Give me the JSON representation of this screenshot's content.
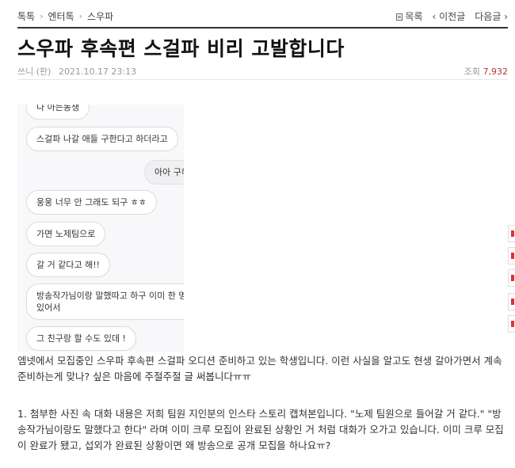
{
  "breadcrumb": {
    "item1": "톡톡",
    "item2": "엔터톡",
    "item3": "스우파"
  },
  "nav": {
    "list": "목록",
    "prev": "이전글",
    "next": "다음글"
  },
  "post": {
    "title": "스우파 후속편 스걸파 비리 고발합니다",
    "author": "쓰니 (판)",
    "date": "2021.10.17 23:13",
    "views_label": "조회",
    "views": "7,932"
  },
  "screenshot_chat": {
    "top_partial": "나 아는동생",
    "msg1": "스걸파 나갈 애들 구한다고 하더라고",
    "msg2": "아아 구해",
    "msg3": "웅웅 너무 안 그래도 되구 ㅎㅎ",
    "msg4": "가면 노제팀으로",
    "msg5": "갈 거 같다고 해!!",
    "msg6": "방송작가님이랑 말했따고 하구 이미 한 명이 있어서",
    "msg7": "그 친구랑 할 수도 있데 !"
  },
  "content": {
    "p1": "엠넷에서 모집중인 스우파 후속편 스걸파 오디션 준비하고 있는 학생입니다. 이런 사실을 알고도 현생 갈아가면서 계속 준비하는게 맞나? 싶은 마음에 주절주절 글 써봅니다ㅠㅠ",
    "p2": "1. 첨부한 사진 속 대화 내용은 저희 팀원 지인분의 인스타 스토리 캡쳐본입니다. \"노제 팀원으로 들어갈 거 같다.\" \"방송작가님이랑도 말했다고 한다\" 라며 이미 크루 모집이 완료된 상황인 거 처럼 대화가 오가고 있습니다. 이미 크루 모집이 완료가 됐고, 섭외가 완료된 상황이면 왜 방송으로 공개 모집을 하나요ㅠ?"
  }
}
